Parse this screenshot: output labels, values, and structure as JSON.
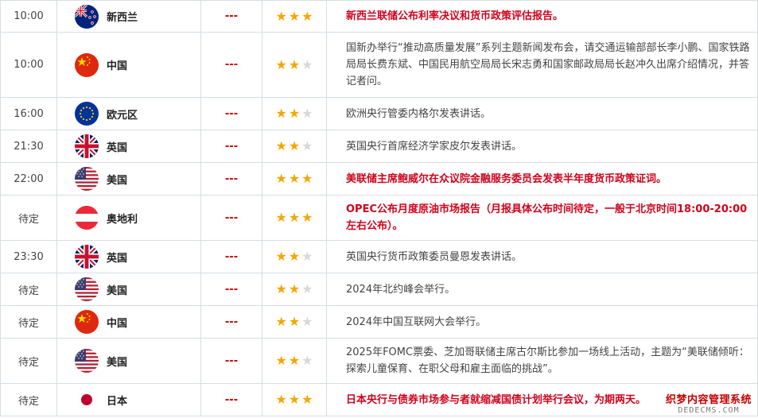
{
  "events": [
    {
      "time": "10:00",
      "flag": "nz-flag-icon",
      "country": "新西兰",
      "importance": "---",
      "stars": 3,
      "highlight": true,
      "desc": "新西兰联储公布利率决议和货币政策评估报告。"
    },
    {
      "time": "10:00",
      "flag": "china-flag-icon",
      "country": "中国",
      "importance": "---",
      "stars": 2,
      "highlight": false,
      "desc": "国新办举行“推动高质量发展”系列主题新闻发布会，请交通运输部部长李小鹏、国家铁路局局长费东斌、中国民用航空局局长宋志勇和国家邮政局局长赵冲久出席介绍情况，并答记者问。"
    },
    {
      "time": "16:00",
      "flag": "eu-flag-icon",
      "country": "欧元区",
      "importance": "---",
      "stars": 2,
      "highlight": false,
      "desc": "欧洲央行管委内格尔发表讲话。"
    },
    {
      "time": "21:30",
      "flag": "uk-flag-icon",
      "country": "英国",
      "importance": "---",
      "stars": 2,
      "highlight": false,
      "desc": "英国央行首席经济学家皮尔发表讲话。"
    },
    {
      "time": "22:00",
      "flag": "us-flag-icon",
      "country": "美国",
      "importance": "---",
      "stars": 3,
      "highlight": true,
      "desc": "美联储主席鲍威尔在众议院金融服务委员会发表半年度货币政策证词。"
    },
    {
      "time": "待定",
      "flag": "austria-flag-icon",
      "country": "奥地利",
      "importance": "---",
      "stars": 3,
      "highlight": true,
      "desc": "OPEC公布月度原油市场报告（月报具体公布时间待定，一般于北京时间18:00-20:00左右公布）。"
    },
    {
      "time": "23:30",
      "flag": "uk-flag-icon",
      "country": "英国",
      "importance": "---",
      "stars": 2,
      "highlight": false,
      "desc": "英国央行货币政策委员曼恩发表讲话。"
    },
    {
      "time": "待定",
      "flag": "us-flag-icon",
      "country": "美国",
      "importance": "---",
      "stars": 2,
      "highlight": false,
      "desc": "2024年北约峰会举行。"
    },
    {
      "time": "待定",
      "flag": "china-flag-icon",
      "country": "中国",
      "importance": "---",
      "stars": 2,
      "highlight": false,
      "desc": "2024年中国互联网大会举行。"
    },
    {
      "time": "待定",
      "flag": "us-flag-icon",
      "country": "美国",
      "importance": "---",
      "stars": 2,
      "highlight": false,
      "desc": "2025年FOMC票委、芝加哥联储主席古尔斯比参加一场线上活动，主题为“美联储倾听：探索儿童保育、在职父母和雇主面临的挑战”。"
    },
    {
      "time": "待定",
      "flag": "japan-flag-icon",
      "country": "日本",
      "importance": "---",
      "stars": 3,
      "highlight": true,
      "desc": "日本央行与债券市场参与者就缩减国债计划举行会议，为期两天。"
    }
  ],
  "watermark": {
    "line1": "织梦内容管理系统",
    "line2": "DEDECMS.COM"
  },
  "colors": {
    "accent_red": "#d0021b",
    "star_on": "#f4a700",
    "star_off": "#d8d8d8",
    "border": "#d6dde5"
  }
}
